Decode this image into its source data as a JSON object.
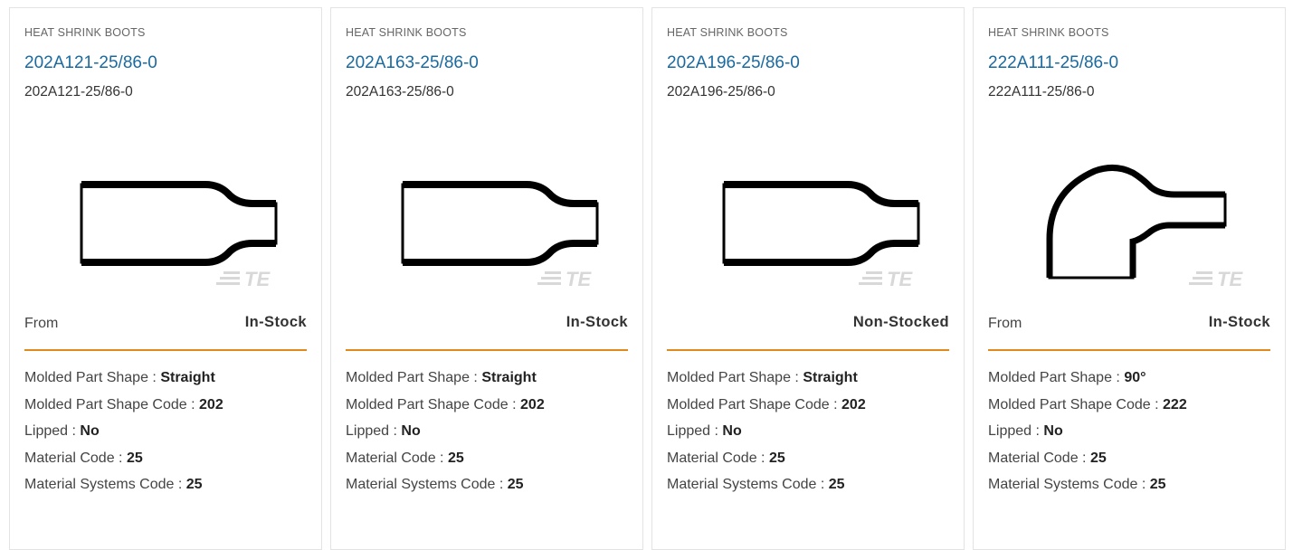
{
  "cards": [
    {
      "category": "HEAT SHRINK BOOTS",
      "title": "202A121-25/86-0",
      "subtitle": "202A121-25/86-0",
      "image": {
        "shape": "straight",
        "logo": "TE"
      },
      "price_label": "From",
      "stock_status": "In-Stock",
      "specs": [
        {
          "label": "Molded Part Shape :",
          "value": "Straight"
        },
        {
          "label": "Molded Part Shape Code :",
          "value": "202"
        },
        {
          "label": "Lipped :",
          "value": "No"
        },
        {
          "label": "Material Code :",
          "value": "25"
        },
        {
          "label": "Material Systems Code :",
          "value": "25"
        }
      ]
    },
    {
      "category": "HEAT SHRINK BOOTS",
      "title": "202A163-25/86-0",
      "subtitle": "202A163-25/86-0",
      "image": {
        "shape": "straight",
        "logo": "TE"
      },
      "price_label": "",
      "stock_status": "In-Stock",
      "specs": [
        {
          "label": "Molded Part Shape :",
          "value": "Straight"
        },
        {
          "label": "Molded Part Shape Code :",
          "value": "202"
        },
        {
          "label": "Lipped :",
          "value": "No"
        },
        {
          "label": "Material Code :",
          "value": "25"
        },
        {
          "label": "Material Systems Code :",
          "value": "25"
        }
      ]
    },
    {
      "category": "HEAT SHRINK BOOTS",
      "title": "202A196-25/86-0",
      "subtitle": "202A196-25/86-0",
      "image": {
        "shape": "straight",
        "logo": "TE"
      },
      "price_label": "",
      "stock_status": "Non-Stocked",
      "specs": [
        {
          "label": "Molded Part Shape :",
          "value": "Straight"
        },
        {
          "label": "Molded Part Shape Code :",
          "value": "202"
        },
        {
          "label": "Lipped :",
          "value": "No"
        },
        {
          "label": "Material Code :",
          "value": "25"
        },
        {
          "label": "Material Systems Code :",
          "value": "25"
        }
      ]
    },
    {
      "category": "HEAT SHRINK BOOTS",
      "title": "222A111-25/86-0",
      "subtitle": "222A111-25/86-0",
      "image": {
        "shape": "elbow",
        "logo": "TE"
      },
      "price_label": "From",
      "stock_status": "In-Stock",
      "specs": [
        {
          "label": "Molded Part Shape :",
          "value": "90°"
        },
        {
          "label": "Molded Part Shape Code :",
          "value": "222"
        },
        {
          "label": "Lipped :",
          "value": "No"
        },
        {
          "label": "Material Code :",
          "value": "25"
        },
        {
          "label": "Material Systems Code :",
          "value": "25"
        }
      ]
    }
  ],
  "colors": {
    "title_link": "#1a6aa0",
    "divider": "#e08a1e",
    "border": "#e3e3e3",
    "logo": "#d8d8d8"
  }
}
